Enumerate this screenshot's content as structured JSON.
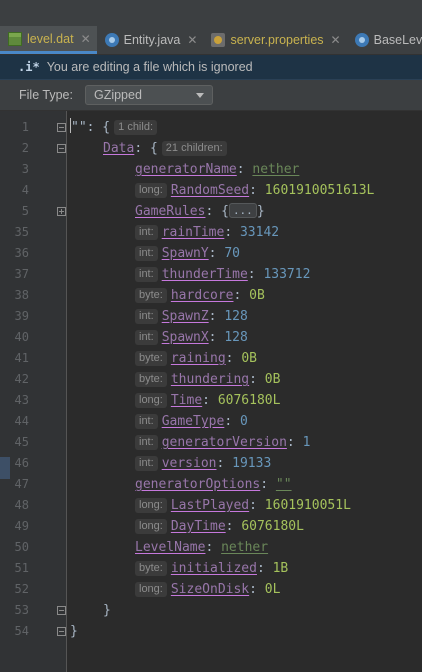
{
  "tabs": [
    {
      "label": "level.dat",
      "icon": "dat-file-icon",
      "active": true,
      "color": "#c9b34f"
    },
    {
      "label": "Entity.java",
      "icon": "java-class-icon",
      "active": false,
      "color": "#bbbbbb"
    },
    {
      "label": "server.properties",
      "icon": "properties-file-icon",
      "active": false,
      "color": "#c9b34f"
    },
    {
      "label": "BaseLevel",
      "icon": "java-class-icon",
      "active": false,
      "color": "#bbbbbb"
    }
  ],
  "banner": {
    "icon": ".i*",
    "text": "You are editing a file which is ignored"
  },
  "file_type": {
    "label": "File Type:",
    "selected": "GZipped"
  },
  "lines": [
    {
      "num": "1",
      "indent": 0,
      "fold": "open",
      "parts": [
        {
          "t": "\"\"",
          "c": "p"
        },
        {
          "t": ": {",
          "c": "p"
        },
        {
          "t": "1 child:",
          "c": "hint ch"
        }
      ]
    },
    {
      "num": "2",
      "indent": 1,
      "fold": "open",
      "parts": [
        {
          "t": "Data",
          "c": "keyb"
        },
        {
          "t": ": {",
          "c": "p"
        },
        {
          "t": "21 children:",
          "c": "hint ch"
        }
      ]
    },
    {
      "num": "3",
      "indent": 2,
      "parts": [
        {
          "t": "generatorName",
          "c": "key"
        },
        {
          "t": ": ",
          "c": "p"
        },
        {
          "t": "nether",
          "c": "str"
        }
      ]
    },
    {
      "num": "4",
      "indent": 2,
      "type": "long:",
      "parts": [
        {
          "t": "RandomSeed",
          "c": "key"
        },
        {
          "t": ": ",
          "c": "p"
        },
        {
          "t": "1601910051613L",
          "c": "grn"
        }
      ]
    },
    {
      "num": "5",
      "indent": 2,
      "fold": "closed",
      "parts": [
        {
          "t": "GameRules",
          "c": "key"
        },
        {
          "t": ": {",
          "c": "p"
        },
        {
          "t": "...",
          "c": "ellip"
        },
        {
          "t": "}",
          "c": "p"
        }
      ]
    },
    {
      "num": "35",
      "indent": 2,
      "type": "int:",
      "parts": [
        {
          "t": "rainTime",
          "c": "key"
        },
        {
          "t": ": ",
          "c": "p"
        },
        {
          "t": "33142",
          "c": "num"
        }
      ]
    },
    {
      "num": "36",
      "indent": 2,
      "type": "int:",
      "parts": [
        {
          "t": "SpawnY",
          "c": "key"
        },
        {
          "t": ": ",
          "c": "p"
        },
        {
          "t": "70",
          "c": "num"
        }
      ]
    },
    {
      "num": "37",
      "indent": 2,
      "type": "int:",
      "parts": [
        {
          "t": "thunderTime",
          "c": "key"
        },
        {
          "t": ": ",
          "c": "p"
        },
        {
          "t": "133712",
          "c": "num"
        }
      ]
    },
    {
      "num": "38",
      "indent": 2,
      "type": "byte:",
      "parts": [
        {
          "t": "hardcore",
          "c": "key"
        },
        {
          "t": ": ",
          "c": "p"
        },
        {
          "t": "0B",
          "c": "grn"
        }
      ]
    },
    {
      "num": "39",
      "indent": 2,
      "type": "int:",
      "parts": [
        {
          "t": "SpawnZ",
          "c": "key"
        },
        {
          "t": ": ",
          "c": "p"
        },
        {
          "t": "128",
          "c": "num"
        }
      ]
    },
    {
      "num": "40",
      "indent": 2,
      "type": "int:",
      "parts": [
        {
          "t": "SpawnX",
          "c": "key"
        },
        {
          "t": ": ",
          "c": "p"
        },
        {
          "t": "128",
          "c": "num"
        }
      ]
    },
    {
      "num": "41",
      "indent": 2,
      "type": "byte:",
      "parts": [
        {
          "t": "raining",
          "c": "key"
        },
        {
          "t": ": ",
          "c": "p"
        },
        {
          "t": "0B",
          "c": "grn"
        }
      ]
    },
    {
      "num": "42",
      "indent": 2,
      "type": "byte:",
      "parts": [
        {
          "t": "thundering",
          "c": "key"
        },
        {
          "t": ": ",
          "c": "p"
        },
        {
          "t": "0B",
          "c": "grn"
        }
      ]
    },
    {
      "num": "43",
      "indent": 2,
      "type": "long:",
      "parts": [
        {
          "t": "Time",
          "c": "key"
        },
        {
          "t": ": ",
          "c": "p"
        },
        {
          "t": "6076180L",
          "c": "grn"
        }
      ]
    },
    {
      "num": "44",
      "indent": 2,
      "type": "int:",
      "parts": [
        {
          "t": "GameType",
          "c": "key"
        },
        {
          "t": ": ",
          "c": "p"
        },
        {
          "t": "0",
          "c": "num"
        }
      ]
    },
    {
      "num": "45",
      "indent": 2,
      "type": "int:",
      "parts": [
        {
          "t": "generatorVersion",
          "c": "key"
        },
        {
          "t": ": ",
          "c": "p"
        },
        {
          "t": "1",
          "c": "num"
        }
      ]
    },
    {
      "num": "46",
      "indent": 2,
      "type": "int:",
      "parts": [
        {
          "t": "version",
          "c": "key"
        },
        {
          "t": ": ",
          "c": "p"
        },
        {
          "t": "19133",
          "c": "num"
        }
      ]
    },
    {
      "num": "47",
      "indent": 2,
      "parts": [
        {
          "t": "generatorOptions",
          "c": "key"
        },
        {
          "t": ": ",
          "c": "p"
        },
        {
          "t": "\"\"",
          "c": "str"
        }
      ]
    },
    {
      "num": "48",
      "indent": 2,
      "type": "long:",
      "parts": [
        {
          "t": "LastPlayed",
          "c": "key"
        },
        {
          "t": ": ",
          "c": "p"
        },
        {
          "t": "1601910051L",
          "c": "grn"
        }
      ]
    },
    {
      "num": "49",
      "indent": 2,
      "type": "long:",
      "parts": [
        {
          "t": "DayTime",
          "c": "key"
        },
        {
          "t": ": ",
          "c": "p"
        },
        {
          "t": "6076180L",
          "c": "grn"
        }
      ]
    },
    {
      "num": "50",
      "indent": 2,
      "parts": [
        {
          "t": "LevelName",
          "c": "key"
        },
        {
          "t": ": ",
          "c": "p"
        },
        {
          "t": "nether",
          "c": "str"
        }
      ]
    },
    {
      "num": "51",
      "indent": 2,
      "type": "byte:",
      "parts": [
        {
          "t": "initialized",
          "c": "key"
        },
        {
          "t": ": ",
          "c": "p"
        },
        {
          "t": "1B",
          "c": "grn"
        }
      ]
    },
    {
      "num": "52",
      "indent": 2,
      "type": "long:",
      "parts": [
        {
          "t": "SizeOnDisk",
          "c": "key"
        },
        {
          "t": ": ",
          "c": "p"
        },
        {
          "t": "0L",
          "c": "grn"
        }
      ]
    },
    {
      "num": "53",
      "indent": 1,
      "fold": "end",
      "parts": [
        {
          "t": "}",
          "c": "p"
        }
      ]
    },
    {
      "num": "54",
      "indent": 0,
      "fold": "end",
      "parts": [
        {
          "t": "}",
          "c": "p"
        }
      ]
    }
  ]
}
